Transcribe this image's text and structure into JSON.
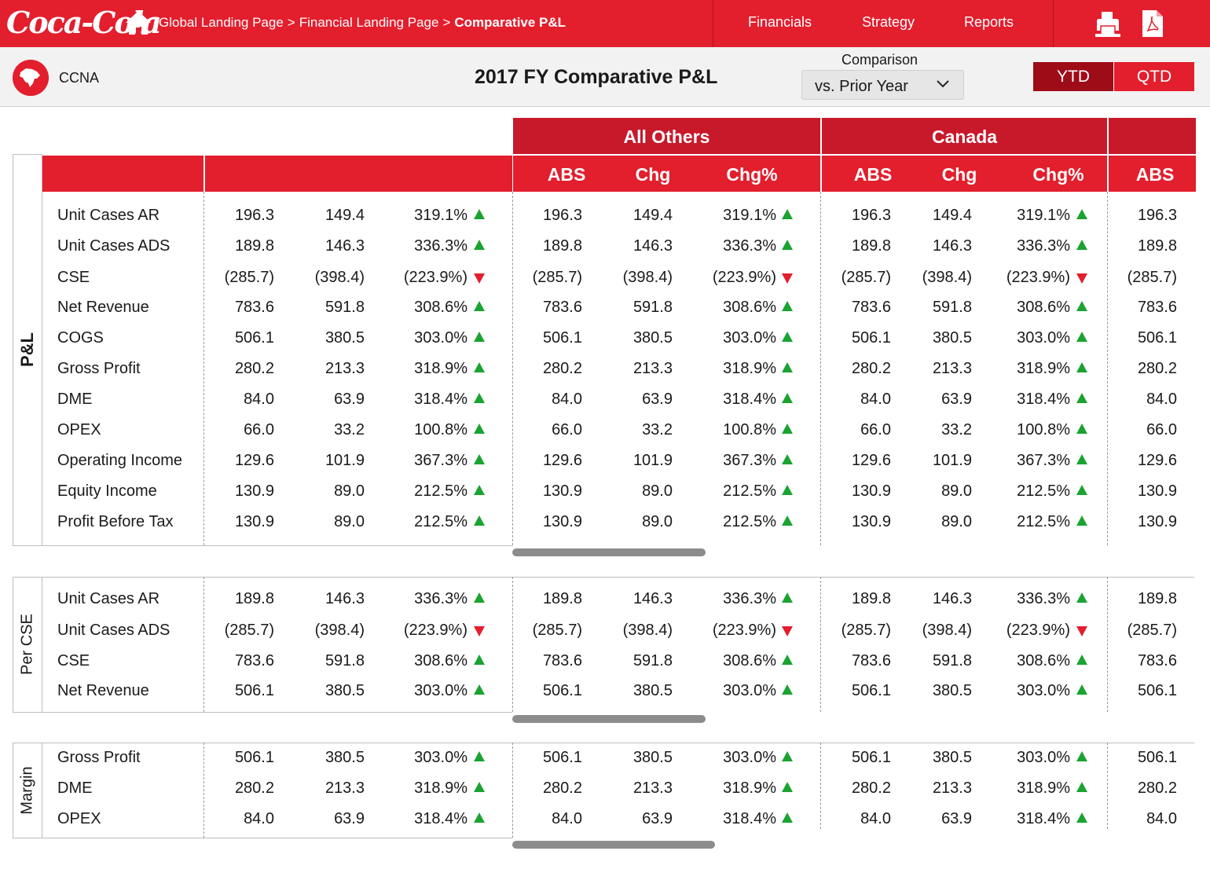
{
  "header": {
    "logo_text": "Coca-Cola",
    "breadcrumb": [
      "Global Landing Page",
      "Financial Landing Page",
      "Comparative P&L"
    ],
    "nav": [
      "Financials",
      "Strategy",
      "Reports"
    ]
  },
  "subheader": {
    "region": "CCNA",
    "title": "2017 FY Comparative P&L",
    "comparison_label": "Comparison",
    "comparison_value": "vs. Prior Year",
    "toggles": [
      "YTD",
      "QTD"
    ]
  },
  "table": {
    "groups": [
      "All Others",
      "Canada"
    ],
    "col_headers": [
      "ABS",
      "Chg",
      "Chg%",
      "ABS",
      "Chg",
      "Chg%",
      "ABS"
    ],
    "sections": [
      {
        "label": "P&L",
        "rows": [
          {
            "name": "Unit Cases AR",
            "v": [
              "196.3",
              "149.4",
              "319.1%"
            ],
            "trend": "up"
          },
          {
            "name": "Unit Cases ADS",
            "v": [
              "189.8",
              "146.3",
              "336.3%"
            ],
            "trend": "up"
          },
          {
            "name": "CSE",
            "v": [
              "(285.7)",
              "(398.4)",
              "(223.9%)"
            ],
            "trend": "down"
          },
          {
            "name": "Net Revenue",
            "v": [
              "783.6",
              "591.8",
              "308.6%"
            ],
            "trend": "up"
          },
          {
            "name": "COGS",
            "v": [
              "506.1",
              "380.5",
              "303.0%"
            ],
            "trend": "up"
          },
          {
            "name": "Gross Profit",
            "v": [
              "280.2",
              "213.3",
              "318.9%"
            ],
            "trend": "up"
          },
          {
            "name": "DME",
            "v": [
              "84.0",
              "63.9",
              "318.4%"
            ],
            "trend": "up"
          },
          {
            "name": "OPEX",
            "v": [
              "66.0",
              "33.2",
              "100.8%"
            ],
            "trend": "up"
          },
          {
            "name": "Operating Income",
            "v": [
              "129.6",
              "101.9",
              "367.3%"
            ],
            "trend": "up"
          },
          {
            "name": "Equity Income",
            "v": [
              "130.9",
              "89.0",
              "212.5%"
            ],
            "trend": "up"
          },
          {
            "name": "Profit Before Tax",
            "v": [
              "130.9",
              "89.0",
              "212.5%"
            ],
            "trend": "up"
          }
        ]
      },
      {
        "label": "Per CSE",
        "rows": [
          {
            "name": "Unit Cases AR",
            "v": [
              "189.8",
              "146.3",
              "336.3%"
            ],
            "trend": "up"
          },
          {
            "name": "Unit Cases ADS",
            "v": [
              "(285.7)",
              "(398.4)",
              "(223.9%)"
            ],
            "trend": "down"
          },
          {
            "name": "CSE",
            "v": [
              "783.6",
              "591.8",
              "308.6%"
            ],
            "trend": "up"
          },
          {
            "name": "Net Revenue",
            "v": [
              "506.1",
              "380.5",
              "303.0%"
            ],
            "trend": "up"
          }
        ]
      },
      {
        "label": "Margin",
        "rows": [
          {
            "name": "Gross Profit",
            "v": [
              "506.1",
              "380.5",
              "303.0%"
            ],
            "trend": "up"
          },
          {
            "name": "DME",
            "v": [
              "280.2",
              "213.3",
              "318.9%"
            ],
            "trend": "up"
          },
          {
            "name": "OPEX",
            "v": [
              "84.0",
              "63.9",
              "318.4%"
            ],
            "trend": "up"
          }
        ]
      }
    ]
  }
}
